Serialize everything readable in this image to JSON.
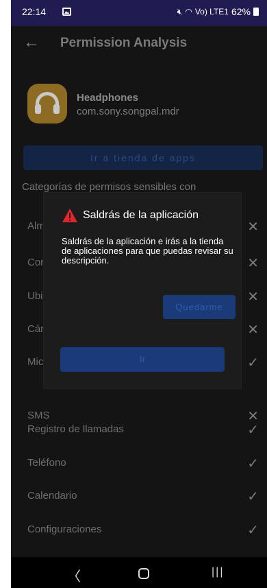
{
  "status_bar": {
    "time": "22:14",
    "signal_text": "Vo) LTE1",
    "battery": "62%"
  },
  "app_bar": {
    "title": "Permission Analysis"
  },
  "app": {
    "name": "Headphones",
    "package": "com.sony.songpal.mdr"
  },
  "store_button": "Ir a tienda de apps",
  "section_title": "Categorías de permisos sensibles con",
  "permissions": [
    {
      "label": "Alm",
      "status": "denied"
    },
    {
      "label": "Cor",
      "status": "denied"
    },
    {
      "label": "Ubi",
      "status": "denied"
    },
    {
      "label": "Cár",
      "status": "denied"
    },
    {
      "label": "Mic",
      "status": "granted"
    },
    {
      "label": "SMS",
      "status": "denied"
    },
    {
      "label": "Registro de llamadas",
      "status": "granted"
    },
    {
      "label": "Teléfono",
      "status": "granted"
    },
    {
      "label": "Calendario",
      "status": "granted"
    },
    {
      "label": "Configuraciones",
      "status": "granted"
    }
  ],
  "icons": {
    "denied": "✕",
    "granted": "✓"
  },
  "dialog": {
    "title": "Saldrás de la aplicación",
    "body": "Saldrás de la aplicación e irás a la tienda de aplicaciones para que puedas revisar su descripción.",
    "stay_button": "Quedarme",
    "go_button": "Ir"
  },
  "colors": {
    "status_bar": "#201c52",
    "background": "#141414",
    "button": "#1a3a7a",
    "warning": "#e0262b"
  }
}
